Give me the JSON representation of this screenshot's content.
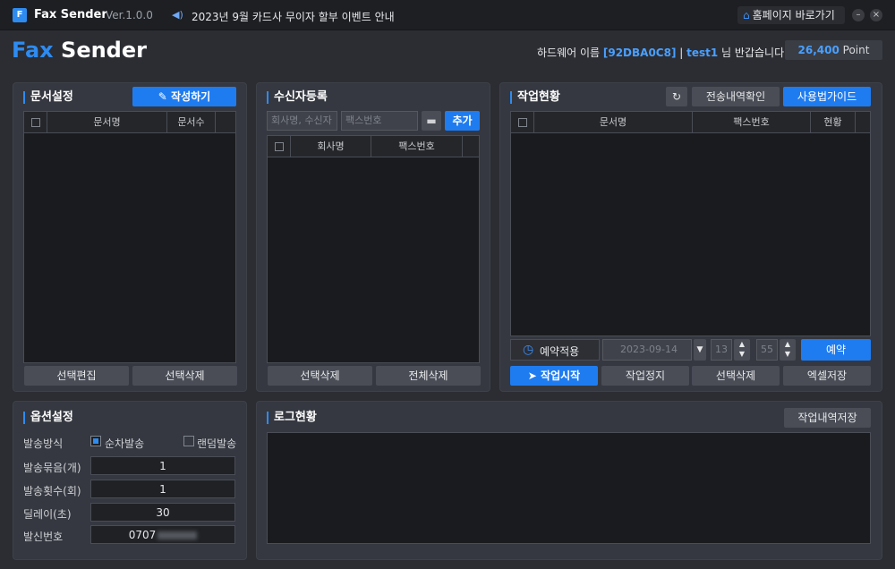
{
  "titlebar": {
    "logo_letter": "F",
    "app_name": "Fax Sender",
    "version": "Ver.1.0.0",
    "speaker_icon": "speaker-icon",
    "notice": "2023년 9월 카드사 무이자 할부 이벤트 안내",
    "home_label": "홈페이지 바로가기",
    "minimize": "–",
    "close": "×"
  },
  "header": {
    "brand_fax": "Fax",
    "brand_sender": " Sender",
    "hw_prefix": "하드웨어 이름 ",
    "hw_id": "[92DBA0C8]",
    "sep": " | ",
    "user": "test1",
    "greeting": " 님 반갑습니다!",
    "points": "26,400",
    "points_unit": " Point"
  },
  "doc_panel": {
    "title": "문서설정",
    "write_button": "작성하기",
    "col_name": "문서명",
    "col_count": "문서수",
    "edit_button": "선택편집",
    "delete_button": "선택삭제"
  },
  "recipient_panel": {
    "title": "수신자등록",
    "name_placeholder": "회사명, 수신자",
    "fax_placeholder": "팩스번호",
    "add_button": "추가",
    "col_company": "회사명",
    "col_fax": "팩스번호",
    "delete_selected": "선택삭제",
    "delete_all": "전체삭제"
  },
  "job_panel": {
    "title": "작업현황",
    "history_button": "전송내역확인",
    "guide_button": "사용법가이드",
    "col_doc": "문서명",
    "col_fax": "팩스번호",
    "col_status": "현황",
    "reserve_label": "예약적용",
    "date": "2023-09-14",
    "hour": "13",
    "minute": "55",
    "reserve_button": "예약",
    "start_button": "작업시작",
    "stop_button": "작업정지",
    "delete_button": "선택삭제",
    "excel_button": "엑셀저장"
  },
  "options_panel": {
    "title": "옵션설정",
    "send_mode_label": "발송방식",
    "mode_sequential": "순차발송",
    "mode_random": "랜덤발송",
    "bundle_label": "발송묶음(개)",
    "bundle_value": "1",
    "repeat_label": "발송횟수(회)",
    "repeat_value": "1",
    "delay_label": "딜레이(초)",
    "delay_value": "30",
    "sender_label": "발신번호",
    "sender_value": "0707"
  },
  "log_panel": {
    "title": "로그현황",
    "save_button": "작업내역저장"
  },
  "colors": {
    "accent": "#1f7cf0",
    "background": "#2b2d33",
    "panel": "#353840"
  }
}
